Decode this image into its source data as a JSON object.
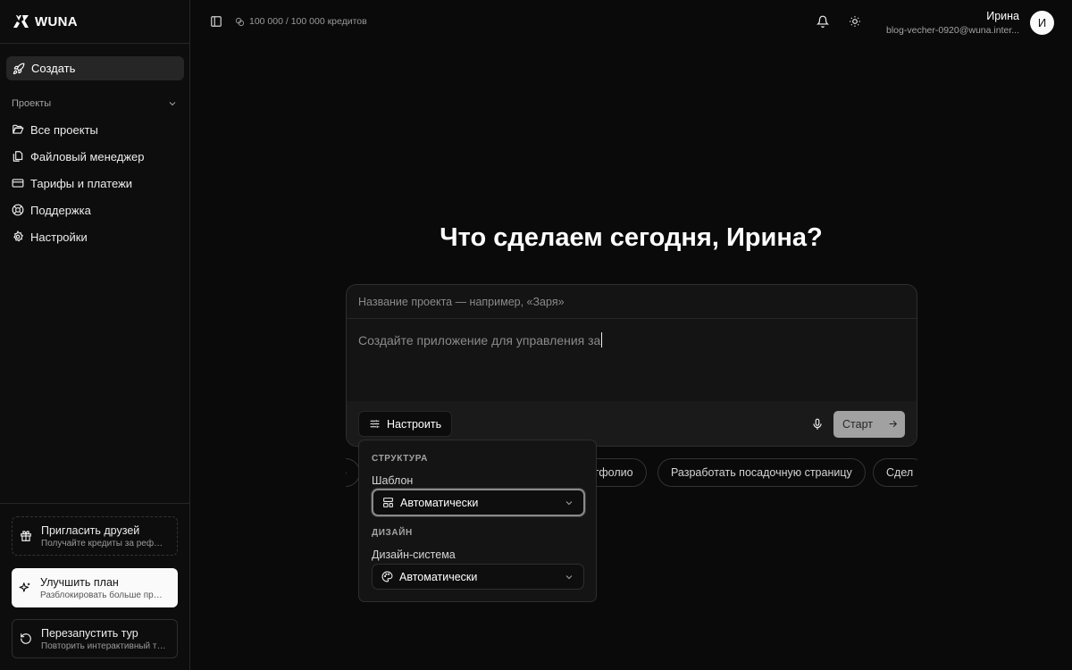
{
  "app": {
    "logo_text": "WUNA"
  },
  "sidebar": {
    "create_label": "Создать",
    "projects_header": "Проекты",
    "items": [
      {
        "label": "Все проекты",
        "icon": "folder-open-icon"
      },
      {
        "label": "Файловый менеджер",
        "icon": "files-icon"
      },
      {
        "label": "Тарифы и платежи",
        "icon": "credit-card-icon"
      },
      {
        "label": "Поддержка",
        "icon": "lifebuoy-icon"
      },
      {
        "label": "Настройки",
        "icon": "gear-icon"
      }
    ],
    "invite": {
      "title": "Пригласить друзей",
      "subtitle": "Получайте кредиты за реферальную программу"
    },
    "upgrade": {
      "title": "Улучшить план",
      "subtitle": "Разблокировать больше преимуществ"
    },
    "tour": {
      "title": "Перезапустить тур",
      "subtitle": "Повторить интерактивный тур"
    }
  },
  "topbar": {
    "credits": "100 000 / 100 000 кредитов",
    "user_name": "Ирина",
    "user_email": "blog-vecher-0920@wuna.inter...",
    "avatar_initial": "И"
  },
  "main": {
    "headline": "Что сделаем сегодня, Ирина?",
    "name_placeholder": "Название проекта — например, «Заря»",
    "prompt_text": "Создайте приложение для управления за",
    "configure_label": "Настроить",
    "start_label": "Старт",
    "chips": [
      "пр",
      "ртфолио",
      "Разработать посадочную страницу",
      "Сдел"
    ]
  },
  "config_panel": {
    "structure_section": "СТРУКТУРА",
    "template_label": "Шаблон",
    "template_value": "Автоматически",
    "design_section": "ДИЗАЙН",
    "design_system_label": "Дизайн-система",
    "design_system_value": "Автоматически"
  }
}
